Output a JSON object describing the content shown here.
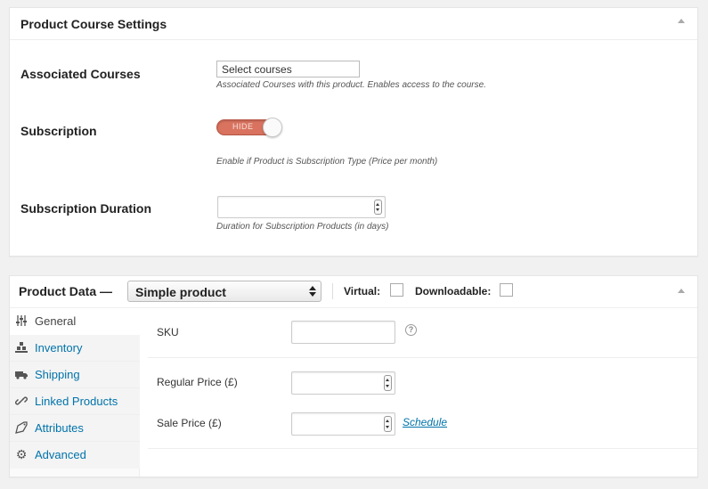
{
  "course_settings": {
    "title": "Product Course Settings",
    "associated_courses": {
      "label": "Associated Courses",
      "value": "Select courses",
      "description": "Associated Courses with this product. Enables access to the course."
    },
    "subscription": {
      "label": "Subscription",
      "toggle_text": "HIDE",
      "description": "Enable if Product is Subscription Type (Price per month)"
    },
    "subscription_duration": {
      "label": "Subscription Duration",
      "value": "",
      "description": "Duration for Subscription Products (in days)"
    }
  },
  "product_data": {
    "title": "Product Data —",
    "type_select": "Simple product",
    "virtual_label": "Virtual:",
    "downloadable_label": "Downloadable:",
    "tabs": [
      {
        "label": "General",
        "icon": "sliders-icon"
      },
      {
        "label": "Inventory",
        "icon": "inventory-icon"
      },
      {
        "label": "Shipping",
        "icon": "truck-icon"
      },
      {
        "label": "Linked Products",
        "icon": "link-icon"
      },
      {
        "label": "Attributes",
        "icon": "tag-icon"
      },
      {
        "label": "Advanced",
        "icon": "gear-icon"
      }
    ],
    "sku_label": "SKU",
    "help_glyph": "?",
    "regular_price_label": "Regular Price (£)",
    "sale_price_label": "Sale Price (£)",
    "schedule_link": "Schedule"
  },
  "colors": {
    "toggle_off": "#d9735f",
    "link": "#0073aa"
  }
}
